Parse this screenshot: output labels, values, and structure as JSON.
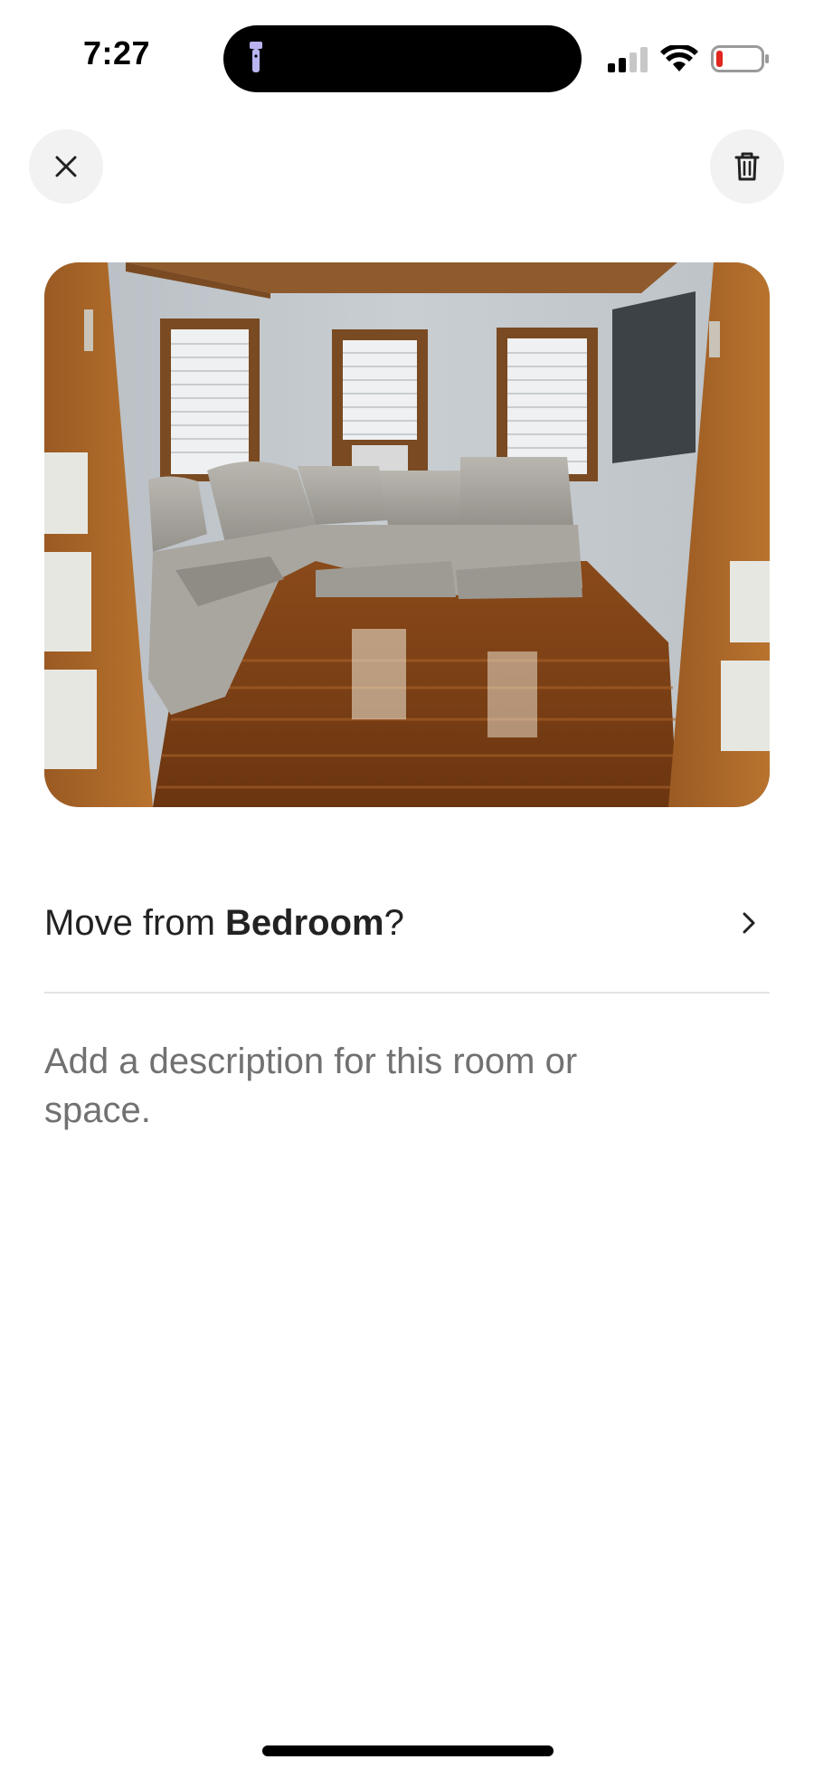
{
  "status_bar": {
    "time": "7:27",
    "icons": [
      "flashlight-icon",
      "cellular-signal-icon",
      "wifi-icon",
      "battery-low-icon"
    ]
  },
  "toolbar": {
    "close_icon": "close-icon",
    "delete_icon": "trash-icon"
  },
  "photo": {
    "subject": "living room photo"
  },
  "move_row": {
    "prefix": "Move from ",
    "room": "Bedroom",
    "suffix": "?",
    "icon": "chevron-right-icon"
  },
  "description": {
    "placeholder": "Add a description for this room or space."
  },
  "colors": {
    "button_bg": "#f2f2f2",
    "text": "#222222",
    "placeholder": "#717171",
    "divider": "#e4e4e4",
    "battery_low": "#e0261f"
  }
}
